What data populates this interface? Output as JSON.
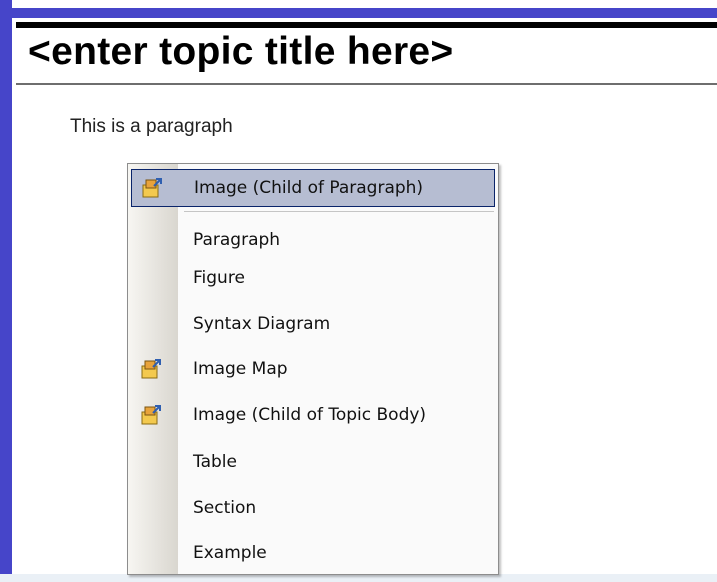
{
  "document": {
    "title": "<enter topic title here>",
    "paragraph": "This is a paragraph"
  },
  "context_menu": {
    "items": [
      {
        "label": "Image (Child of Paragraph)",
        "icon": "image-insert-icon",
        "selected": true
      },
      {
        "label": "Paragraph",
        "icon": ""
      },
      {
        "label": "Figure",
        "icon": ""
      },
      {
        "label": "Syntax Diagram",
        "icon": ""
      },
      {
        "label": "Image Map",
        "icon": "image-insert-icon"
      },
      {
        "label": "Image (Child of Topic Body)",
        "icon": "image-insert-icon"
      },
      {
        "label": "Table",
        "icon": ""
      },
      {
        "label": "Section",
        "icon": ""
      },
      {
        "label": "Example",
        "icon": ""
      }
    ]
  },
  "colors": {
    "frame": "#4645c9",
    "highlight": "#b6bdd2",
    "highlight_border": "#0a246a"
  }
}
